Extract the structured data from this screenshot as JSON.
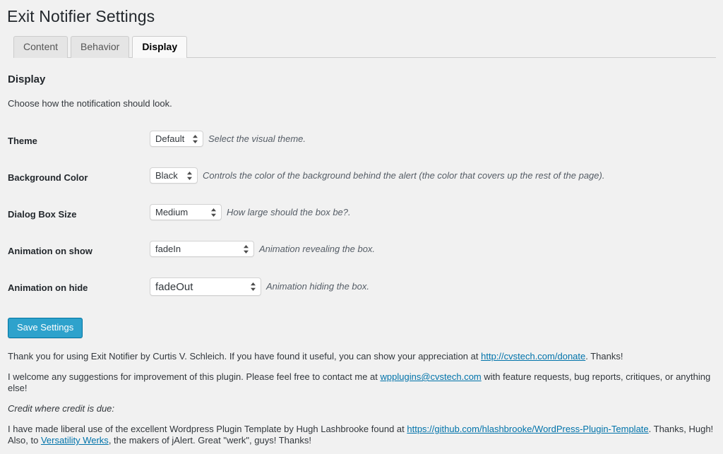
{
  "page": {
    "title": "Exit Notifier Settings"
  },
  "tabs": [
    {
      "label": "Content",
      "active": false
    },
    {
      "label": "Behavior",
      "active": false
    },
    {
      "label": "Display",
      "active": true
    }
  ],
  "section": {
    "heading": "Display",
    "description": "Choose how the notification should look."
  },
  "fields": [
    {
      "label": "Theme",
      "value": "Default",
      "description": "Select the visual theme."
    },
    {
      "label": "Background Color",
      "value": "Black",
      "description": "Controls the color of the background behind the alert (the color that covers up the rest of the page)."
    },
    {
      "label": "Dialog Box Size",
      "value": "Medium",
      "description": "How large should the box be?."
    },
    {
      "label": "Animation on show",
      "value": "fadeIn",
      "description": "Animation revealing the box."
    },
    {
      "label": "Animation on hide",
      "value": "fadeOut",
      "description": "Animation hiding the box."
    }
  ],
  "submit": {
    "label": "Save Settings"
  },
  "footer": {
    "line1_before": "Thank you for using Exit Notifier by Curtis V. Schleich. If you have found it useful, you can show your appreciation at ",
    "line1_link": "http://cvstech.com/donate",
    "line1_after": ". Thanks!",
    "line2_before": "I welcome any suggestions for improvement of this plugin. Please feel free to contact me at ",
    "line2_link": "wpplugins@cvstech.com",
    "line2_after": " with feature requests, bug reports, critiques, or anything else!",
    "credit_heading": "Credit where credit is due:",
    "line3_before": "I have made liberal use of the excellent Wordpress Plugin Template by Hugh Lashbrooke found at ",
    "line3_link": "https://github.com/hlashbrooke/WordPress-Plugin-Template",
    "line3_after": ". Thanks, Hugh!",
    "line4_before": "Also, to ",
    "line4_link": "Versatility Werks",
    "line4_after": ", the makers of jAlert. Great \"werk\", guys! Thanks!"
  },
  "colors": {
    "background": "#f1f1f1",
    "link": "#0073aa",
    "primary_button": "#2ea2cc",
    "primary_button_border": "#0074a2"
  }
}
